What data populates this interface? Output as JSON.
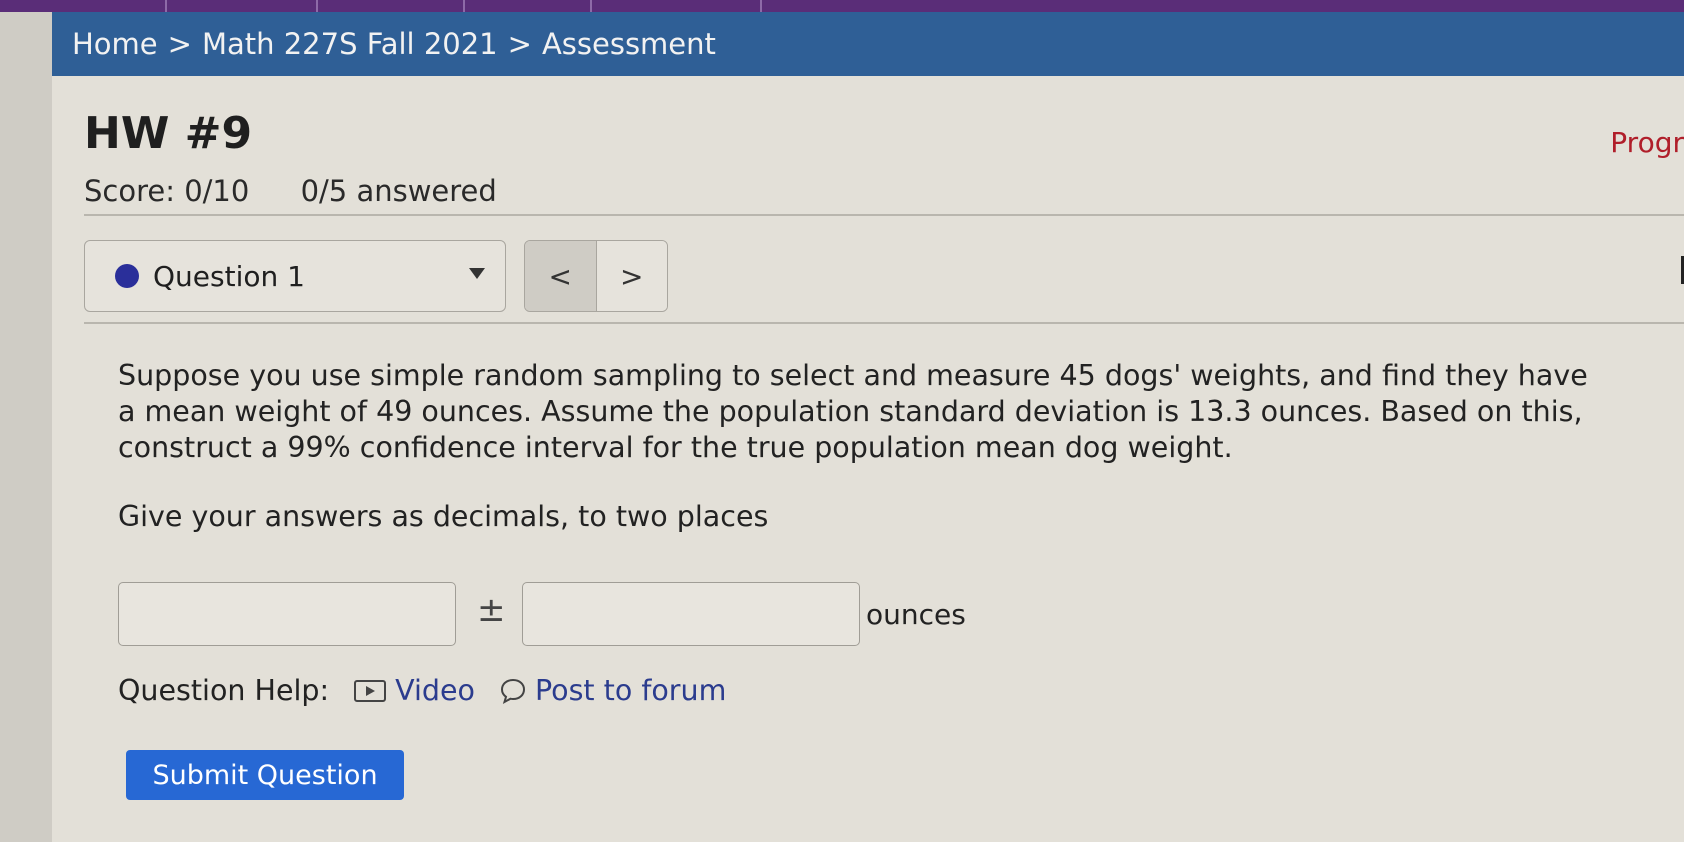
{
  "breadcrumb": {
    "items": [
      "Home",
      "Math 227S Fall 2021",
      "Assessment"
    ],
    "separator": ">"
  },
  "assignment": {
    "title": "HW #9",
    "progress_link": "Progr",
    "score": "Score: 0/10",
    "answered": "0/5 answered"
  },
  "question_nav": {
    "selected": "Question 1",
    "prev_symbol": "<",
    "next_symbol": ">"
  },
  "question": {
    "text": "Suppose you use simple random sampling to select and measure 45 dogs' weights, and find they have a mean weight of 49 ounces. Assume the population standard deviation is 13.3 ounces. Based on this, construct a 99% confidence interval for the true population mean dog weight.",
    "instructions": "Give your answers as decimals, to two places",
    "answer_1_value": "",
    "answer_2_value": "",
    "plus_minus": "±",
    "units": "ounces"
  },
  "help": {
    "label": "Question Help:",
    "video_label": "Video",
    "forum_label": "Post to forum"
  },
  "submit_label": "Submit Question",
  "colors": {
    "breadcrumb_bar": "#2f5f96",
    "top_strip": "#5a2d78",
    "progress_link": "#b01e2a",
    "question_dot": "#2a2f9a",
    "help_link": "#2b3c8e",
    "submit_button": "#2768d4"
  }
}
